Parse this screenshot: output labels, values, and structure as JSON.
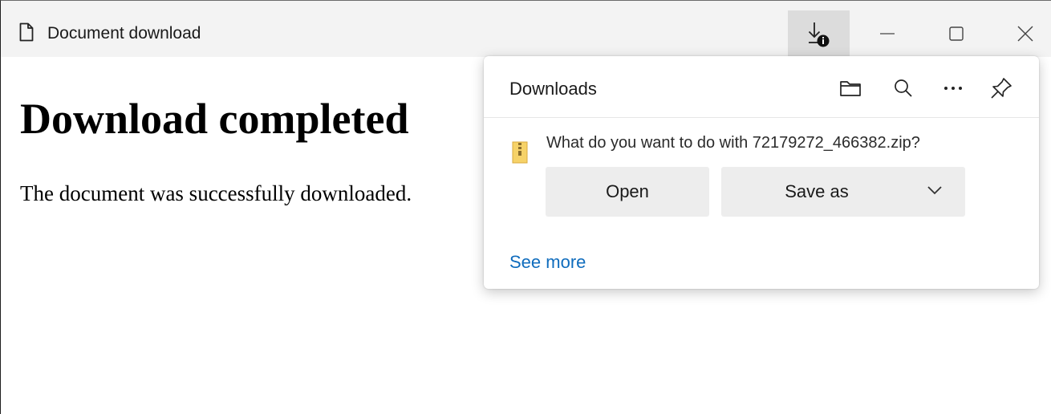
{
  "window": {
    "title": "Document download"
  },
  "titlebar": {
    "icons": {
      "page": "page-icon",
      "download": "download-info-icon",
      "minimize": "minimize-icon",
      "maximize": "maximize-icon",
      "close": "close-icon"
    }
  },
  "page": {
    "heading": "Download completed",
    "message": "The document was successfully downloaded."
  },
  "downloads_panel": {
    "title": "Downloads",
    "icons": {
      "folder": "folder-icon",
      "search": "search-icon",
      "more": "more-icon",
      "pin": "pin-icon",
      "file": "zip-file-icon"
    },
    "prompt": "What do you want to do with 72179272_466382.zip?",
    "open_label": "Open",
    "save_as_label": "Save as",
    "see_more_label": "See more"
  },
  "colors": {
    "link": "#0f6cbd",
    "button_bg": "#ededed",
    "titlebar_bg": "#f3f3f3",
    "active_download_button_bg": "#dcdcdc"
  }
}
